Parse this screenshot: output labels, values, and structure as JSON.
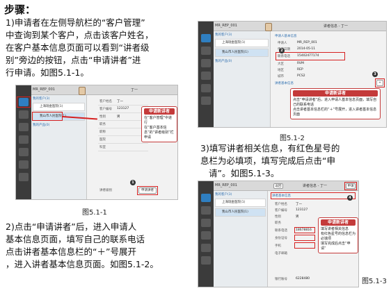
{
  "heading": "步骤：",
  "steps": {
    "step1": [
      "1)申请者在左侧导航栏的“客户管理”",
      "中查询到某个客户，点击该客户姓名，",
      "在客户基本信息页面可以看到“讲者级",
      "别”旁边的按钮，点击“申请讲者”进",
      "行申请。如图5.1-1。"
    ],
    "step2": [
      "2)点击“申请讲者”后，进入申请人",
      "基本信息页面，填写自己的联系电话",
      "点击讲者基本信息栏的“＋”号展开",
      "，进入讲者基本信息页面。如图5.1-2。"
    ],
    "step3": [
      "3)填写讲者相关信息，有红色星号的",
      "息栏为必填项，填写完成后点击“申",
      "请”。如图5.1-3。"
    ]
  },
  "captions": {
    "fig1": "图5.1-1",
    "fig2": "图5.1-2",
    "fig3": "图5.1-3"
  },
  "shots": {
    "fig1": {
      "user": "MR_REP_001",
      "header_title": "丁一",
      "list_header_1": "我的客户(3)",
      "list_rows": [
        "上海瑞金医院(1)",
        "我山市人民医院(1)"
      ],
      "list_header_2": "我的产品(0)",
      "form": [
        [
          "客户姓名",
          "丁一"
        ],
        [
          "客户编号",
          "123127"
        ],
        [
          "性别",
          "男"
        ],
        [
          "职务",
          ""
        ],
        [
          "职称",
          ""
        ],
        [
          "医院",
          ""
        ],
        [
          "科室",
          ""
        ],
        [
          "讲者级别",
          ""
        ]
      ],
      "apply_btn": "申请讲者",
      "callout_title": "申请新讲者",
      "callout_items": [
        "在“客户管理”中进行",
        "在“客户基本信息”的“讲者级别”栏申请"
      ]
    },
    "fig2": {
      "user": "MR_REP_001",
      "header_title": "讲者信息 - 丁一",
      "section1": "申请人基本信息",
      "form": [
        [
          "申请人",
          "MR_REP_001"
        ],
        [
          "申请日期",
          "2014-05-11"
        ],
        [
          "联系电话",
          "15402477174"
        ],
        [
          "大区",
          "RVM"
        ],
        [
          "地区",
          "REP"
        ],
        [
          "城市",
          "PCS2"
        ]
      ],
      "section2": "讲者基本信息",
      "callout_title": "申请新讲者",
      "callout_items": [
        "点击“申请讲者”后，进入申请人基本信息页面，填写自己的联系电话",
        "点击讲者基本信息栏的“＋”号展开，进入讲者基本信息页面"
      ]
    },
    "fig3": {
      "user": "MR_REP_001",
      "header_title": "讲者信息 - 丁一",
      "back": "返回",
      "apply": "申请",
      "section": "讲者基本信息",
      "form": [
        [
          "客户姓名",
          "丁一"
        ],
        [
          "客户编号",
          "123127"
        ],
        [
          "性别",
          "男"
        ],
        [
          "职务",
          ""
        ],
        [
          "联系电话",
          "18678816"
        ],
        [
          "身份证号",
          ""
        ],
        [
          "手机",
          ""
        ],
        [
          "电子邮箱",
          ""
        ],
        [
          "银行账号",
          "6228480"
        ]
      ],
      "callout_title": "申请新讲者",
      "callout_items": [
        "填写讲者相关信息",
        "有红色星号的信息栏为必填项",
        "填写完成后点击“申请”"
      ]
    }
  }
}
